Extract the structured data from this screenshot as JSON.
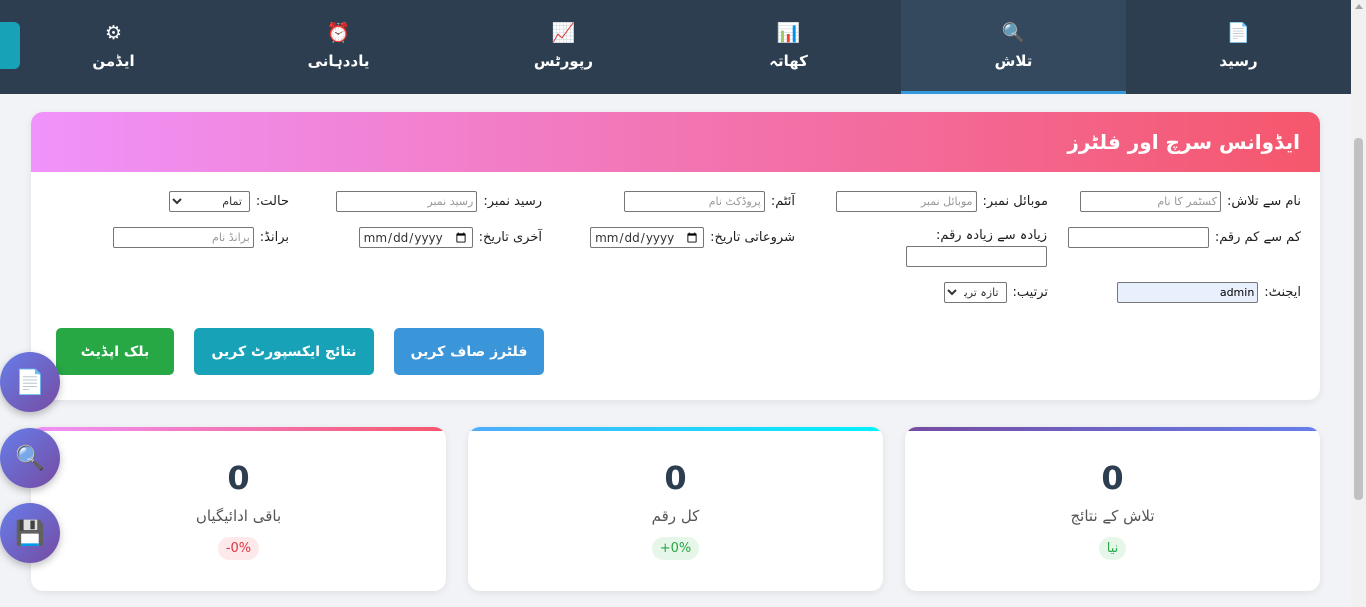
{
  "nav": {
    "tabs": [
      {
        "icon": "📄",
        "icon_name": "receipt-icon",
        "label": "رسید"
      },
      {
        "icon": "🔍",
        "icon_name": "search-icon",
        "label": "تلاش"
      },
      {
        "icon": "📊",
        "icon_name": "ledger-chart-icon",
        "label": "کھاتہ"
      },
      {
        "icon": "📈",
        "icon_name": "reports-chart-icon",
        "label": "رپورٹس"
      },
      {
        "icon": "⏰",
        "icon_name": "alarm-clock-icon",
        "label": "یاددہانی"
      },
      {
        "icon": "⚙",
        "icon_name": "gear-icon",
        "label": "ایڈمن"
      }
    ],
    "active_tab": "تلاش"
  },
  "search": {
    "title": "ایڈوانس سرچ اور فلٹرز",
    "name_search": {
      "label": "نام سے تلاش:",
      "placeholder": "کسٹمر کا نام"
    },
    "mobile": {
      "label": "موبائل نمبر:",
      "placeholder": "موبائل نمبر"
    },
    "item": {
      "label": "آئٹم:",
      "placeholder": "پروڈکٹ نام"
    },
    "receipt_no": {
      "label": "رسید نمبر:",
      "placeholder": "رسید نمبر"
    },
    "status": {
      "label": "حالت:",
      "value": "تمام"
    },
    "min_amount": {
      "label": "کم سے کم رقم:"
    },
    "max_amount": {
      "label": "زیادہ سے زیادہ رقم:"
    },
    "start_date": {
      "label": "شروعاتی تاریخ:",
      "value": "mm/dd/yyyy"
    },
    "end_date": {
      "label": "آخری تاریخ:",
      "value": "mm/dd/yyyy"
    },
    "brand": {
      "label": "برانڈ:",
      "placeholder": "برانڈ نام"
    },
    "agent": {
      "label": "ایجنٹ:",
      "value": "admin"
    },
    "sort": {
      "label": "ترتیب:",
      "value": "تازہ ترین"
    },
    "buttons": {
      "clear": "فلٹرز صاف کریں",
      "export": "نتائج ایکسپورٹ کریں",
      "bulk": "بلک اپڈیٹ"
    }
  },
  "stats": [
    {
      "value": "0",
      "label": "تلاش کے نتائج",
      "badge": "نیا",
      "bar_color": "linear-gradient(90deg,#764ba2,#667eea)"
    },
    {
      "value": "0",
      "label": "کل رقم",
      "badge": "+0%",
      "bar_color": "linear-gradient(90deg,#4facfe,#00f2fe)"
    },
    {
      "value": "0",
      "label": "باقی ادائیگیاں",
      "badge": "-0%",
      "bar_color": "linear-gradient(90deg,#f5576c,#f093fb)"
    }
  ],
  "fabs": [
    {
      "icon": "📄",
      "name": "receipt-icon"
    },
    {
      "icon": "🔍",
      "name": "search-icon"
    },
    {
      "icon": "💾",
      "name": "save-icon"
    }
  ],
  "colors": {
    "nav_bg": "#2c3e50",
    "active_tab_bg": "#34495e",
    "accent": "#3498db"
  }
}
